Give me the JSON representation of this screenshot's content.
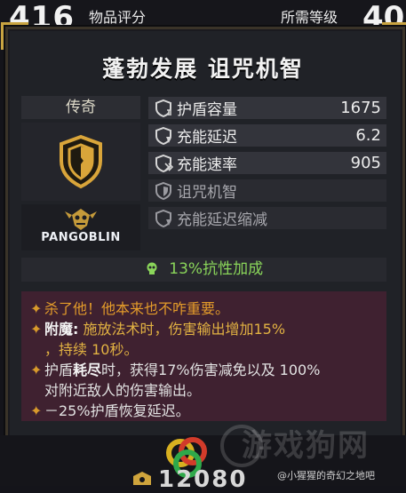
{
  "header": {
    "item_score": "416",
    "item_score_label": "物品评分",
    "required_level_label": "所需等级",
    "required_level": "40"
  },
  "item": {
    "name": "蓬勃发展 诅咒机智",
    "rarity": "传奇",
    "brand": "PANGOBLIN",
    "icon": "shield-icon"
  },
  "stats": [
    {
      "label": "护盾容量",
      "value": "1675",
      "icon": "shield-stat-icon",
      "active": true
    },
    {
      "label": "充能延迟",
      "value": "6.2",
      "icon": "shield-stat-icon",
      "active": true
    },
    {
      "label": "充能速率",
      "value": "905",
      "icon": "shield-stat-icon",
      "active": true
    },
    {
      "label": "诅咒机智",
      "value": "",
      "icon": "shield-stat-icon",
      "active": false
    },
    {
      "label": "充能延迟缩减",
      "value": "",
      "icon": "shield-stat-icon",
      "active": false
    }
  ],
  "bonus": {
    "text": "13%抗性加成",
    "icon": "skull-icon",
    "color": "#8ad55a"
  },
  "description": {
    "line1": "杀了他！他本来也不咋重要。",
    "line2_keyword": "附魔:",
    "line2_text": "施放法术时，伤害输出增加15%",
    "line3_text": "，持续 10秒。",
    "line4_a": "护盾",
    "line4_b": "耗尽",
    "line4_c": "时，获得17%伤害减免以及 100%",
    "line5_text": "对附近敌人的伤害输出。",
    "line6_text": "－25%护盾恢复延迟。"
  },
  "footer": {
    "cost": "12080",
    "watermark": "游戏狗网",
    "credit": "@小猩猩的奇幻之地吧"
  },
  "colors": {
    "accent_gold": "#d9a53a",
    "description_bg": "#3f2130",
    "bonus_green": "#8ad55a"
  }
}
